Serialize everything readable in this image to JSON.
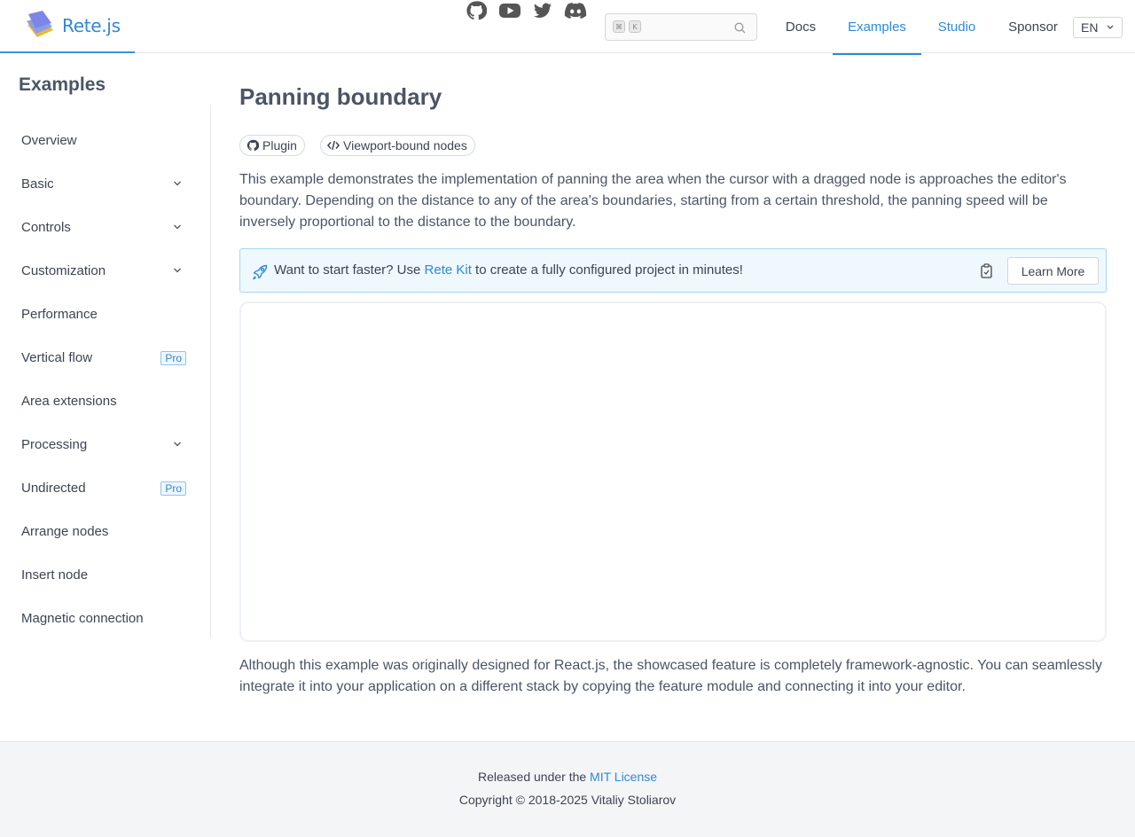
{
  "header": {
    "brand": "Rete.js",
    "social": [
      "github-icon",
      "youtube-icon",
      "twitter-icon",
      "discord-icon"
    ],
    "search": {
      "kbd_mod": "⌘",
      "kbd_key": "K"
    },
    "nav": [
      "Docs",
      "Examples",
      "Studio",
      "Sponsor"
    ],
    "lang": "EN"
  },
  "sidebar": {
    "title": "Examples",
    "items": [
      {
        "label": "Overview",
        "expandable": false,
        "badge": ""
      },
      {
        "label": "Basic",
        "expandable": true,
        "badge": ""
      },
      {
        "label": "Controls",
        "expandable": true,
        "badge": ""
      },
      {
        "label": "Customization",
        "expandable": true,
        "badge": ""
      },
      {
        "label": "Performance",
        "expandable": false,
        "badge": ""
      },
      {
        "label": "Vertical flow",
        "expandable": false,
        "badge": "Pro"
      },
      {
        "label": "Area extensions",
        "expandable": false,
        "badge": ""
      },
      {
        "label": "Processing",
        "expandable": true,
        "badge": ""
      },
      {
        "label": "Undirected",
        "expandable": false,
        "badge": "Pro"
      },
      {
        "label": "Arrange nodes",
        "expandable": false,
        "badge": ""
      },
      {
        "label": "Insert node",
        "expandable": false,
        "badge": ""
      },
      {
        "label": "Magnetic connection",
        "expandable": false,
        "badge": ""
      }
    ]
  },
  "main": {
    "title": "Panning boundary",
    "tags": [
      "Plugin",
      "Viewport-bound nodes"
    ],
    "description": "This example demonstrates the implementation of panning the area when the cursor with a dragged node is approaches the editor's boundary. Depending on the distance to any of the area's boundaries, starting from a certain threshold, the panning speed will be inversely proportional to the distance to the boundary.",
    "alert": {
      "before": "Want to start faster? Use ",
      "link": "Rete Kit",
      "after": " to create a fully configured project in minutes!",
      "button": "Learn More"
    },
    "note": "Although this example was originally designed for React.js, the showcased feature is completely framework-agnostic. You can seamlessly integrate it into your application on a different stack by copying the feature module and connecting it into your editor."
  },
  "footer": {
    "released_prefix": "Released under the ",
    "license_link": "MIT License",
    "copyright": "Copyright © 2018-2025 Vitaliy Stoliarov"
  },
  "colors": {
    "accent": "#2f89d6",
    "text": "#4b5565",
    "alert_bg": "#eef8fd",
    "alert_border": "#a5d8f3",
    "footer_bg": "#f4f5f7"
  }
}
